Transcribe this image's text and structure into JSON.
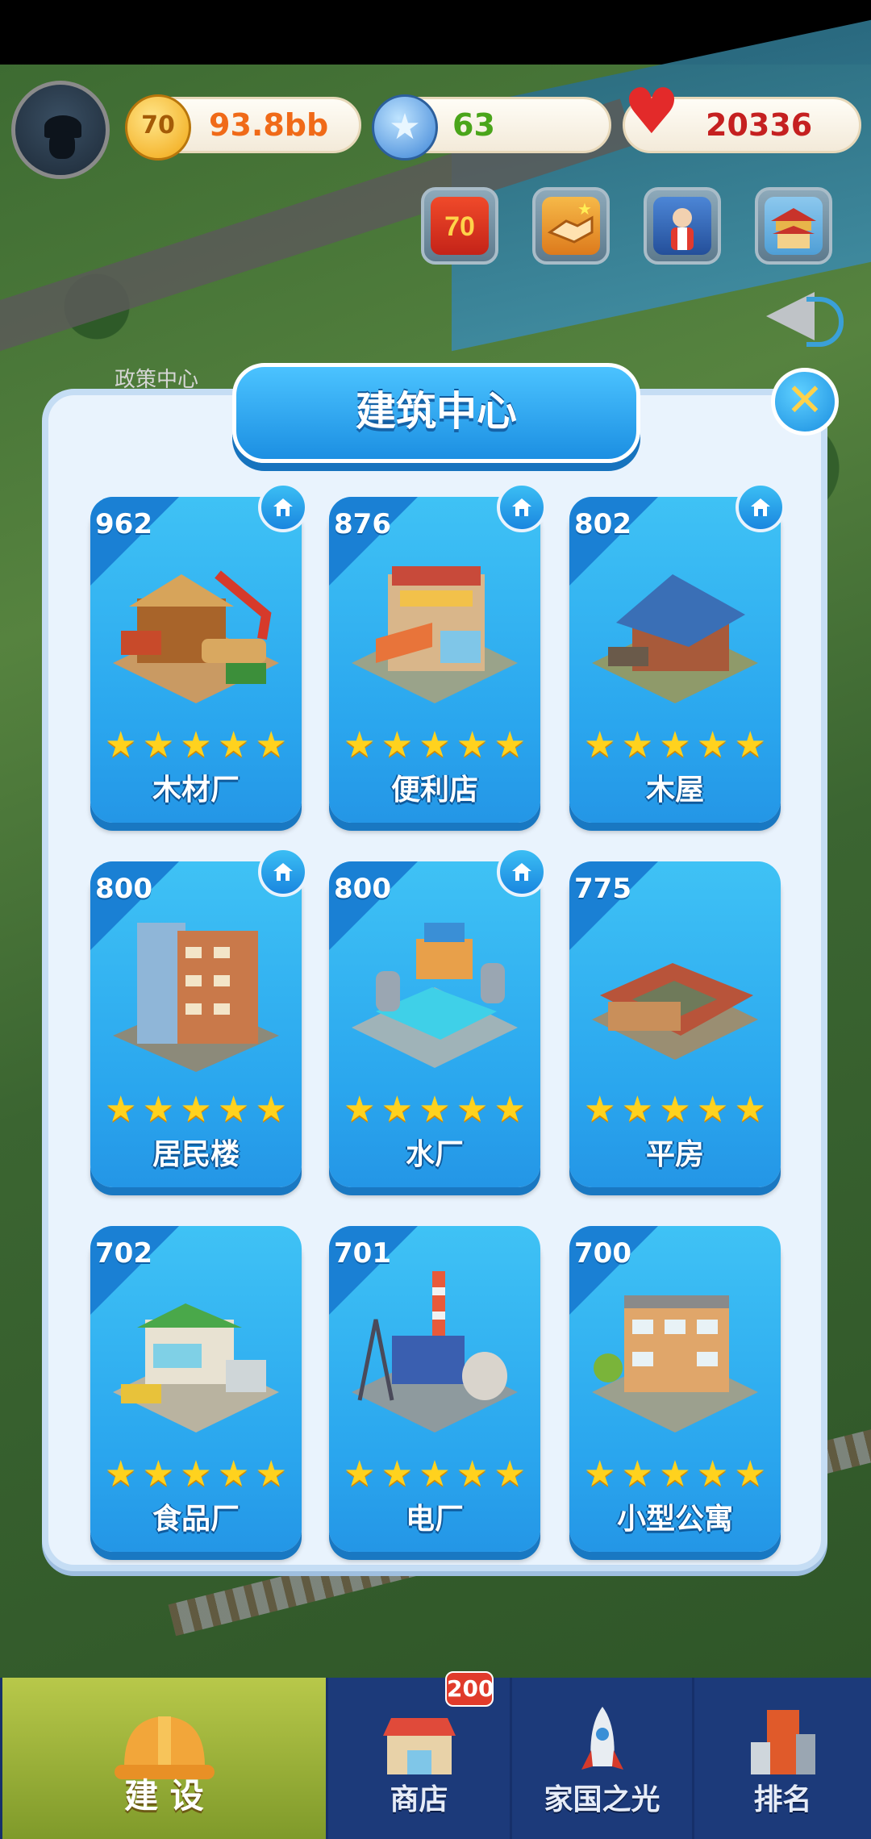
{
  "currency": {
    "coins": {
      "icon": "coin-icon",
      "value": "93.8bb"
    },
    "stars": {
      "icon": "blue-star-icon",
      "value": "63"
    },
    "hearts": {
      "icon": "heart-icon",
      "value": "20336"
    }
  },
  "quick_buttons": [
    {
      "icon": "anniversary-70-icon"
    },
    {
      "icon": "handshake-icon"
    },
    {
      "icon": "character-event-icon"
    },
    {
      "icon": "temple-building-icon"
    }
  ],
  "map_label": "政策中心",
  "panel": {
    "title": "建筑中心",
    "cards": [
      {
        "score": "962",
        "name": "木材厂",
        "stars": 5,
        "home": true
      },
      {
        "score": "876",
        "name": "便利店",
        "stars": 5,
        "home": true
      },
      {
        "score": "802",
        "name": "木屋",
        "stars": 5,
        "home": true
      },
      {
        "score": "800",
        "name": "居民楼",
        "stars": 5,
        "home": true
      },
      {
        "score": "800",
        "name": "水厂",
        "stars": 5,
        "home": true
      },
      {
        "score": "775",
        "name": "平房",
        "stars": 5,
        "home": false
      },
      {
        "score": "702",
        "name": "食品厂",
        "stars": 5,
        "home": false
      },
      {
        "score": "701",
        "name": "电厂",
        "stars": 5,
        "home": false
      },
      {
        "score": "700",
        "name": "小型公寓",
        "stars": 5,
        "home": false
      }
    ]
  },
  "nav": [
    {
      "label": "建 设",
      "icon": "hard-hat-icon",
      "active": true
    },
    {
      "label": "商店",
      "icon": "shop-icon",
      "badge": "200"
    },
    {
      "label": "家国之光",
      "icon": "rocket-icon"
    },
    {
      "label": "排名",
      "icon": "ranking-icon"
    }
  ],
  "colors": {
    "accent": "#2aa6ee",
    "coin_text": "#f06a18",
    "star_text": "#4aa51a",
    "heart_text": "#c52020"
  }
}
